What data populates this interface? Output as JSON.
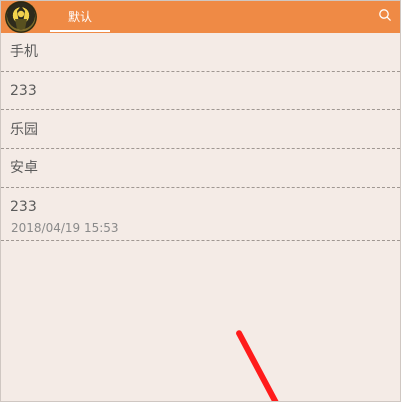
{
  "header": {
    "tab_label": "默认",
    "search_icon": "search-icon",
    "background_color": "#ef8a45"
  },
  "list": {
    "items": [
      {
        "title": "手机"
      },
      {
        "title": "233"
      },
      {
        "title": "乐园"
      },
      {
        "title": "安卓"
      },
      {
        "title": "233",
        "date": "2018/04/19 15:53"
      }
    ]
  },
  "colors": {
    "background": "#f4ebe6",
    "divider": "#9f9792",
    "text": "#5b5b5b",
    "date_text": "#8a8a8a",
    "red_stroke": "#ff1b1b"
  }
}
